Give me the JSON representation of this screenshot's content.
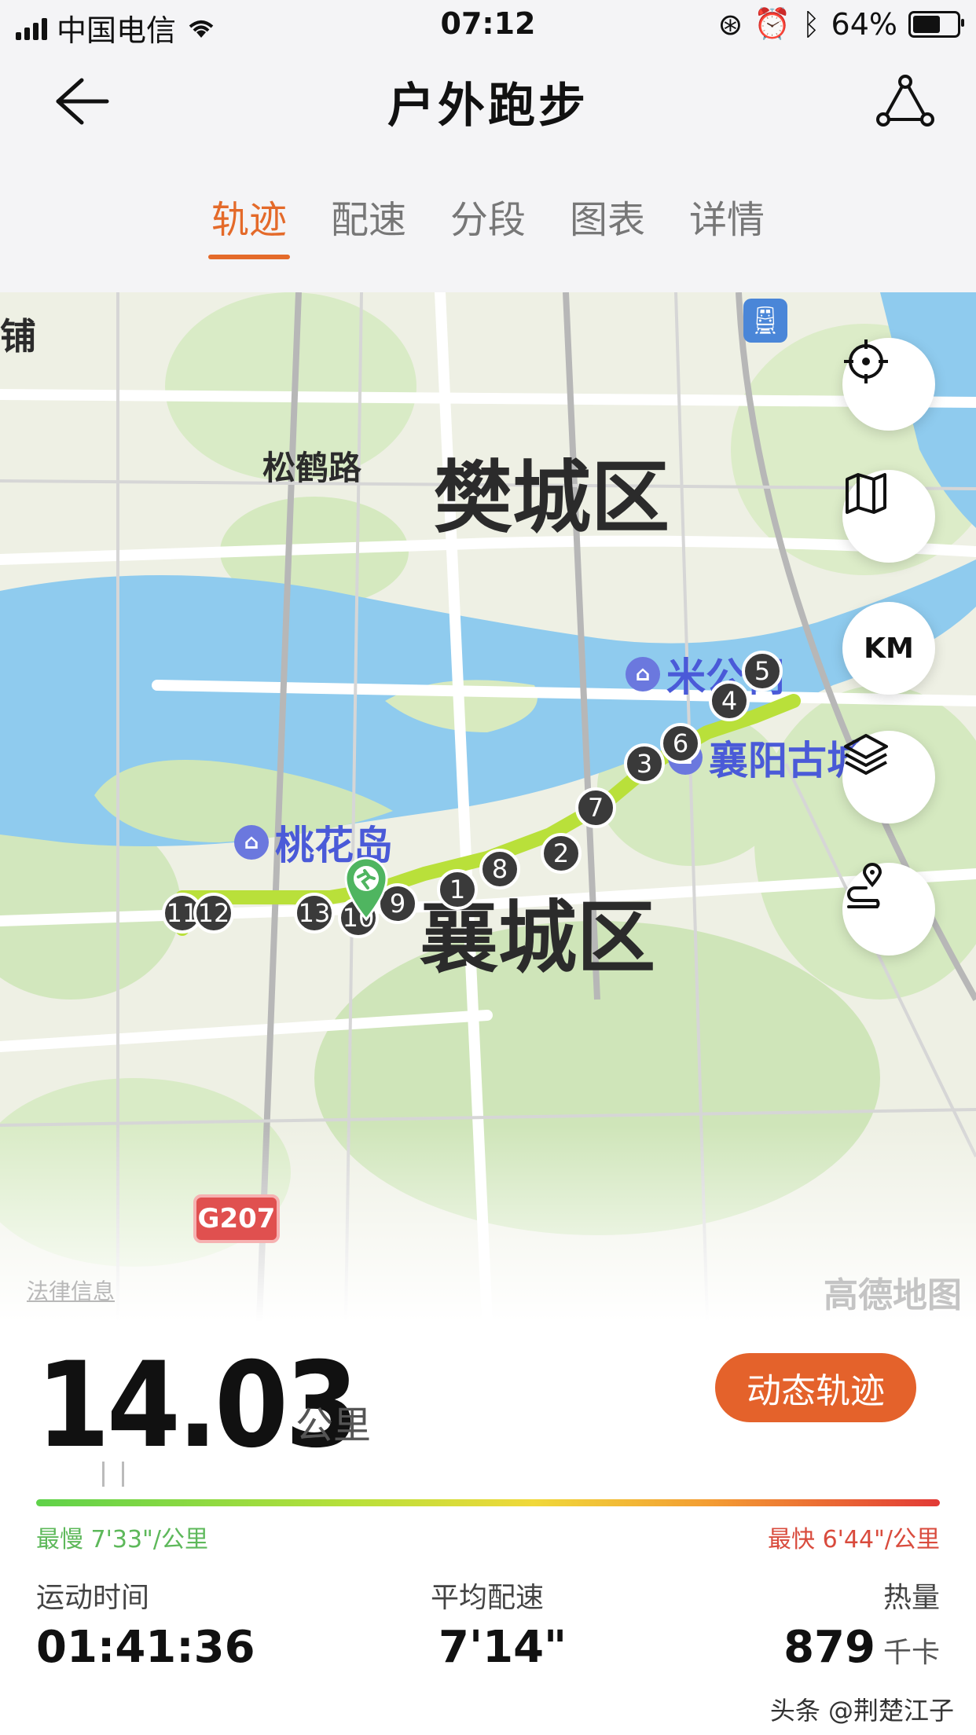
{
  "status_bar": {
    "carrier": "中国电信",
    "time": "07:12",
    "battery": "64%"
  },
  "header": {
    "title": "户外跑步"
  },
  "tabs": [
    {
      "label": "轨迹",
      "active": true
    },
    {
      "label": "配速",
      "active": false
    },
    {
      "label": "分段",
      "active": false
    },
    {
      "label": "图表",
      "active": false
    },
    {
      "label": "详情",
      "active": false
    }
  ],
  "map": {
    "district_labels": [
      "樊城区",
      "襄城区"
    ],
    "road_label": "松鹤路",
    "edge_label": "铺",
    "pois": [
      {
        "label": "米公祠",
        "icon": "temple-icon"
      },
      {
        "label": "襄阳古城",
        "icon": "temple-icon"
      },
      {
        "label": "桃花岛",
        "icon": "temple-icon"
      }
    ],
    "km_markers": [
      "1",
      "2",
      "3",
      "4",
      "5",
      "6",
      "7",
      "8",
      "9",
      "10",
      "11",
      "12",
      "13"
    ],
    "highway": "G207",
    "legal_link": "法律信息",
    "watermark": "高德地图",
    "controls": [
      {
        "name": "locate-button",
        "icon": "crosshair-icon"
      },
      {
        "name": "map-type-button",
        "icon": "map-icon"
      },
      {
        "name": "km-button",
        "label": "KM"
      },
      {
        "name": "layers-button",
        "icon": "layers-icon"
      },
      {
        "name": "route-button",
        "icon": "route-pin-icon"
      }
    ]
  },
  "summary": {
    "distance": "14.03",
    "distance_unit": "公里",
    "dynamic_track_button": "动态轨迹",
    "slowest": "最慢 7'33\"/公里",
    "fastest": "最快 6'44\"/公里",
    "stats": [
      {
        "label": "运动时间",
        "value": "01:41:36",
        "unit": ""
      },
      {
        "label": "平均配速",
        "value": "7'14\"",
        "unit": ""
      },
      {
        "label": "热量",
        "value": "879",
        "unit": "千卡"
      }
    ],
    "credit": "头条 @荆楚江子"
  },
  "colors": {
    "accent": "#e46a2a",
    "route_start": "#5fd24a",
    "route_end": "#e23a36"
  }
}
